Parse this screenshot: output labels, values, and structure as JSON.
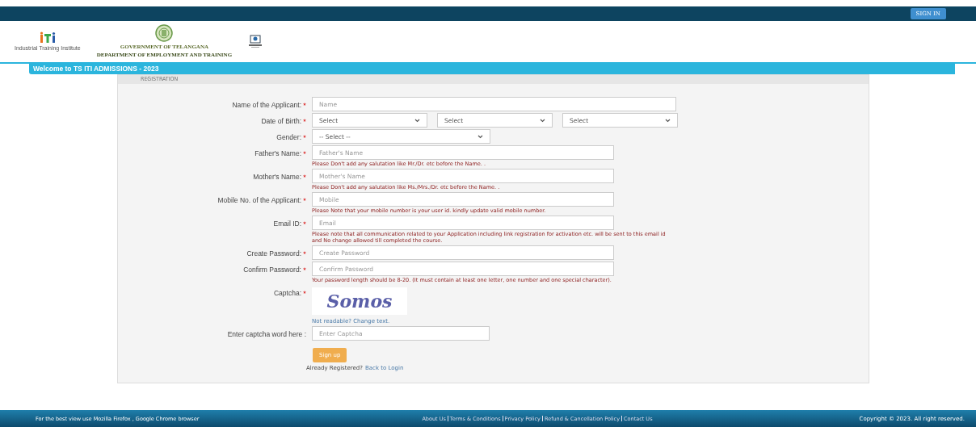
{
  "top_bar": {
    "sign_in": "SIGN IN"
  },
  "header": {
    "iti_caption": "Industrial Training Institute",
    "gov_line1": "GOVERNMENT OF TELANGANA",
    "gov_line2": "DEPARTMENT OF EMPLOYMENT AND TRAINING"
  },
  "welcome": "Welcome to TS ITI ADMISSIONS - 2023",
  "panel": {
    "title": "REGISTRATION",
    "rows": [
      {
        "kind": "wide_input",
        "label": "Name of the Applicant:",
        "required": true,
        "placeholder": "Name"
      },
      {
        "kind": "selects",
        "label": "Date of Birth:",
        "required": true,
        "selects": [
          "Select",
          "Select",
          "Select"
        ]
      },
      {
        "kind": "select",
        "label": "Gender:",
        "required": true,
        "value": "-- Select --"
      },
      {
        "kind": "input",
        "label": "Father's Name: ",
        "required": true,
        "placeholder": "Father's Name",
        "hint": "Please Don't add any salutation like Mr./Dr. etc before the Name. ."
      },
      {
        "kind": "input",
        "label": "Mother's Name: ",
        "required": true,
        "placeholder": "Mother's Name",
        "hint": "Please Don't add any salutation like Ms./Mrs./Dr. etc before the Name. ."
      },
      {
        "kind": "input",
        "label": "Mobile No. of the Applicant:",
        "required": true,
        "placeholder": "Mobile",
        "hint": "Please Note that your mobile number is your user id. kindly update valid mobile number."
      },
      {
        "kind": "input",
        "label": "Email ID:",
        "required": true,
        "placeholder": "Email",
        "hint": "Please note that all communication related to your Application including link registration for activation etc. will be sent to this email id and No change allowed till completed the course."
      },
      {
        "kind": "input",
        "label": "Create Password:",
        "required": true,
        "placeholder": "Create Password"
      },
      {
        "kind": "input",
        "label": "Confirm Password:",
        "required": true,
        "placeholder": "Confirm Password",
        "hint": "Your password length should be 8-20. (It must contain at least one letter, one number and one special character)."
      },
      {
        "kind": "captcha",
        "label": "Captcha:",
        "required": true,
        "captcha_text": "Somos",
        "link": "Not readable? Change text."
      },
      {
        "kind": "short_input",
        "label": "Enter captcha word here :",
        "required": false,
        "placeholder": "Enter Captcha"
      }
    ],
    "submit": "Sign up",
    "login_prompt": "Already Registered?",
    "login_link": "Back to Login"
  },
  "footer": {
    "left": "For the best view use Mozilla Firefox , Google Chrome browser",
    "links": [
      "About Us",
      "Terms & Conditions",
      "Privacy Policy",
      "Refund & Cancellation Policy",
      "Contact Us"
    ],
    "right": "Copyright © 2023. All right reserved."
  }
}
